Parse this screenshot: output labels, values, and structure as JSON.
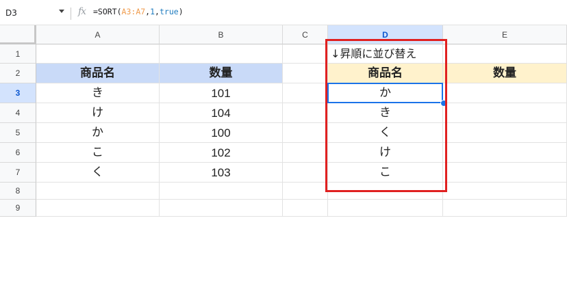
{
  "namebox": {
    "value": "D3"
  },
  "formula_bar": {
    "fx_label": "fx",
    "prefix": "=SORT(",
    "range": "A3:A7",
    "comma1": ",",
    "col_arg": "1",
    "comma2": ",",
    "bool_arg": "true",
    "suffix": ")"
  },
  "columns": [
    "A",
    "B",
    "C",
    "D",
    "E"
  ],
  "rows": [
    "1",
    "2",
    "3",
    "4",
    "5",
    "6",
    "7",
    "8",
    "9"
  ],
  "selected_cell": "D3",
  "colors": {
    "header_blue": "#c9daf8",
    "header_yellow": "#fff2cc",
    "selection": "#1a73e8",
    "highlight_box": "#e02020"
  },
  "sheet": {
    "d1_note": "↓昇順に並び替え",
    "left_table": {
      "headers": [
        "商品名",
        "数量"
      ],
      "rows": [
        [
          "き",
          "101"
        ],
        [
          "け",
          "104"
        ],
        [
          "か",
          "100"
        ],
        [
          "こ",
          "102"
        ],
        [
          "く",
          "103"
        ]
      ]
    },
    "right_table": {
      "headers": [
        "商品名",
        "数量"
      ],
      "sorted_names": [
        "か",
        "き",
        "く",
        "け",
        "こ"
      ]
    }
  }
}
